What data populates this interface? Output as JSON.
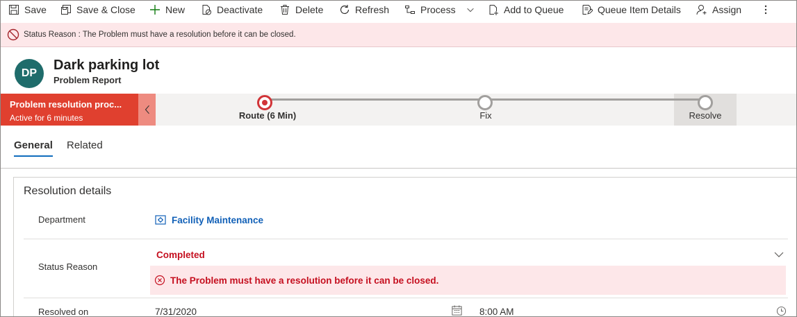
{
  "toolbar": {
    "save": "Save",
    "save_close": "Save & Close",
    "new": "New",
    "deactivate": "Deactivate",
    "delete": "Delete",
    "refresh": "Refresh",
    "process": "Process",
    "add_to_queue": "Add to Queue",
    "queue_item_details": "Queue Item Details",
    "assign": "Assign"
  },
  "notification": {
    "text": "Status Reason : The Problem must have a resolution before it can be closed."
  },
  "header": {
    "initials": "DP",
    "title": "Dark parking lot",
    "entity": "Problem Report"
  },
  "bpf": {
    "process_name": "Problem resolution proc...",
    "active_time": "Active for 6 minutes",
    "stages": [
      {
        "label": "Route  (6 Min)"
      },
      {
        "label": "Fix"
      },
      {
        "label": "Resolve"
      }
    ]
  },
  "tabs": [
    "General",
    "Related"
  ],
  "section": {
    "title": "Resolution details",
    "department_label": "Department",
    "department_value": "Facility Maintenance",
    "status_label": "Status Reason",
    "status_value": "Completed",
    "status_error": "The Problem must have a resolution before it can be closed.",
    "resolved_label": "Resolved on",
    "resolved_date": "7/31/2020",
    "resolved_time": "8:00 AM"
  },
  "colors": {
    "accent": "#0f6cbd",
    "error": "#c50f1f",
    "bpf_active": "#e0402f",
    "avatar": "#1f6c6b"
  }
}
